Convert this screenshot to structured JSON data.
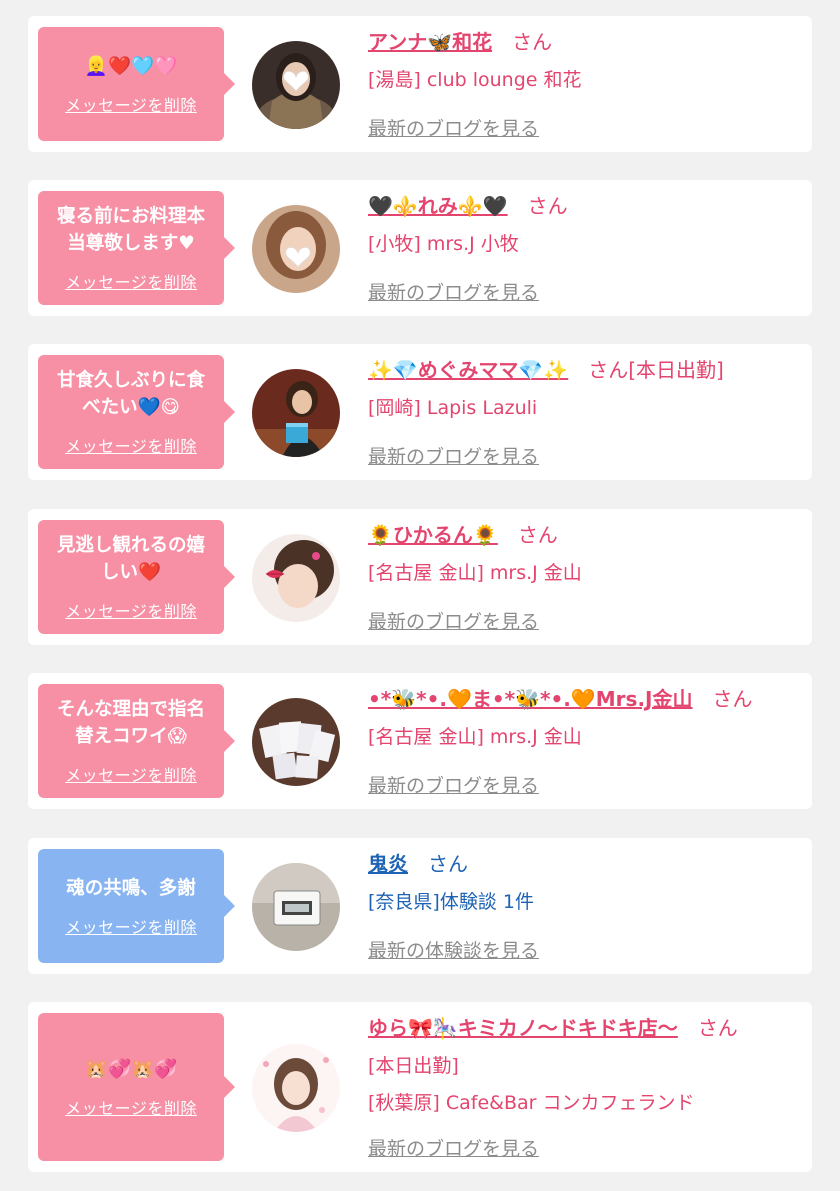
{
  "messages": [
    {
      "bubble_text": "👱‍♀️❤️🩵🩷",
      "delete_label": "メッセージを削除",
      "name": "アンナ🦋和花",
      "honorific": "さん",
      "status": "",
      "lines": [
        "[湯島] club lounge 和花"
      ],
      "link_label": "最新のブログを見る",
      "theme": "pink",
      "avatar": "avatar-woman-heart-sticker"
    },
    {
      "bubble_text": "寝る前にお料理本\n当尊敬します♥",
      "delete_label": "メッセージを削除",
      "name": "🖤⚜️れみ⚜️🖤",
      "honorific": "さん",
      "status": "",
      "lines": [
        "[小牧] mrs.J 小牧"
      ],
      "link_label": "最新のブログを見る",
      "theme": "pink",
      "avatar": "avatar-woman-heart-sticker"
    },
    {
      "bubble_text": "甘食久しぶりに食\nべたい💙😋",
      "delete_label": "メッセージを削除",
      "name": "✨💎めぐみママ💎✨",
      "honorific": "さん",
      "status": "[本日出勤]",
      "lines": [
        "[岡崎] Lapis Lazuli"
      ],
      "link_label": "最新のブログを見る",
      "theme": "pink",
      "avatar": "avatar-woman-with-gift"
    },
    {
      "bubble_text": "見逃し観れるの嬉\nしい❤️",
      "delete_label": "メッセージを削除",
      "name": "🌻ひかるん🌻",
      "honorific": "さん",
      "status": "",
      "lines": [
        "[名古屋 金山] mrs.J 金山"
      ],
      "link_label": "最新のブログを見る",
      "theme": "pink",
      "avatar": "avatar-woman-lips-sticker"
    },
    {
      "bubble_text": "そんな理由で指名\n替えコワイ😱",
      "delete_label": "メッセージを削除",
      "name": "•*🐝*•.🧡ま•*🐝*•.🧡Mrs.J金山",
      "honorific": "さん",
      "status": "",
      "lines": [
        "[名古屋 金山] mrs.J 金山"
      ],
      "link_label": "最新のブログを見る",
      "theme": "pink",
      "avatar": "avatar-cards"
    },
    {
      "bubble_text": "魂の共鳴、多謝",
      "delete_label": "メッセージを削除",
      "name": "鬼炎",
      "honorific": "さん",
      "status": "",
      "lines": [
        "[奈良県]体験談 1件"
      ],
      "link_label": "最新の体験談を見る",
      "theme": "blue",
      "avatar": "avatar-clock-display"
    },
    {
      "bubble_text": "🐹💞🐹💞",
      "delete_label": "メッセージを削除",
      "name": "ゆら🎀🎠キミカノ～ドキドキ店～",
      "honorific": "さん",
      "status": "",
      "lines": [
        "[本日出勤]",
        "[秋葉原] Cafe&Bar コンカフェランド"
      ],
      "link_label": "最新のブログを見る",
      "theme": "pink",
      "avatar": "avatar-woman-photo"
    }
  ]
}
